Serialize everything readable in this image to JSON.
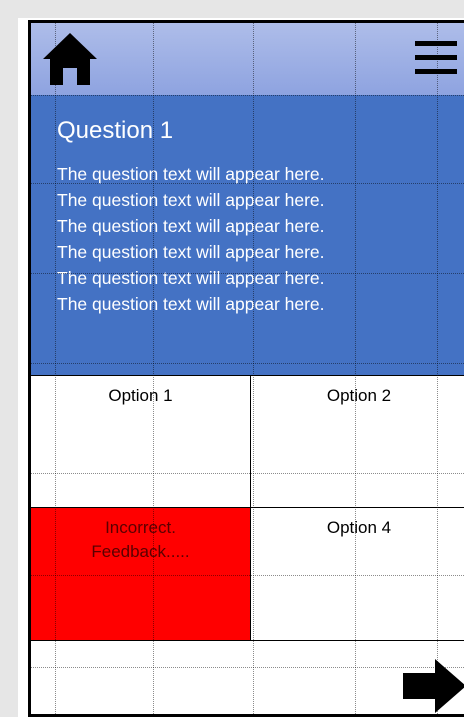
{
  "header": {
    "home_icon": "home-icon",
    "menu_icon": "hamburger-menu-icon"
  },
  "question": {
    "title": "Question 1",
    "lines": [
      "The question text will appear here.",
      "The question text will appear here.",
      "The question text will appear here.",
      "The question text will appear here.",
      "The question text will appear here.",
      "The question text will appear here."
    ]
  },
  "options": [
    {
      "label": "Option 1"
    },
    {
      "label": "Option 2"
    },
    {
      "label": "Incorrect.\nFeedback....."
    },
    {
      "label": "Option 4"
    }
  ],
  "colors": {
    "header": "#8ea3e0",
    "question_bg": "#4472c4",
    "incorrect_bg": "#ff0000"
  },
  "footer": {
    "next_icon": "next-arrow-icon"
  }
}
